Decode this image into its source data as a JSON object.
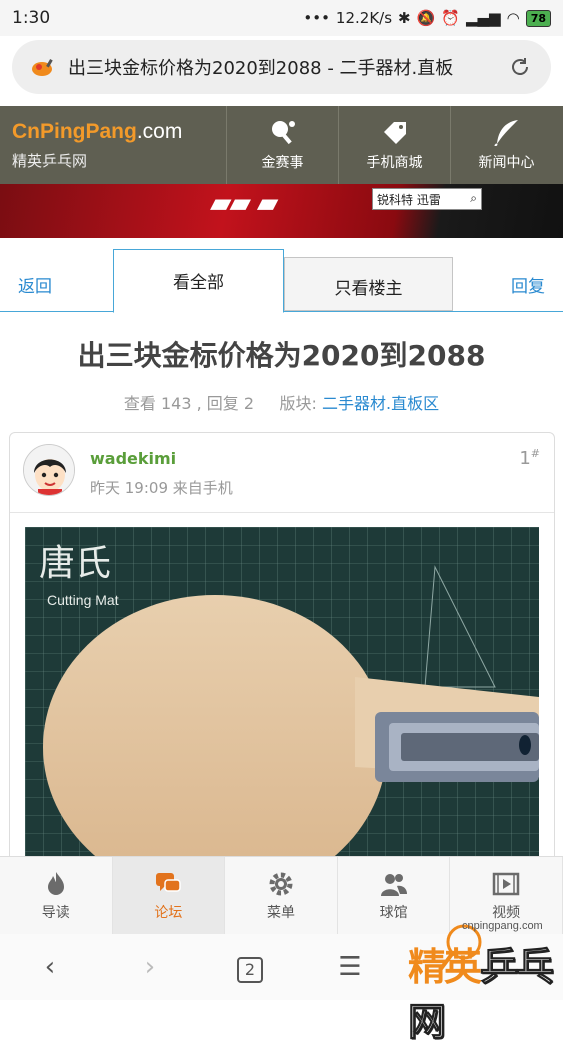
{
  "status_bar": {
    "time": "1:30",
    "network_speed": "12.2K/s",
    "battery": "78"
  },
  "browser": {
    "url_title": "出三块金标价格为2020到2088 - 二手器材.直板",
    "tab_count": "2"
  },
  "site": {
    "logo_brand": "CnPingPang",
    "logo_tld": ".com",
    "logo_subtitle": "精英乒乓网",
    "nav": [
      {
        "label": "金赛事",
        "icon": "paddle-icon"
      },
      {
        "label": "手机商城",
        "icon": "tag-icon"
      },
      {
        "label": "新闻中心",
        "icon": "feather-icon"
      }
    ]
  },
  "banner": {
    "search_text": "锐科特 迅雷"
  },
  "tabs": {
    "back": "返回",
    "all": "看全部",
    "op_only": "只看楼主",
    "reply": "回复"
  },
  "thread": {
    "title": "出三块金标价格为2020到2088",
    "views_label": "查看",
    "views": "143",
    "replies_label": "回复",
    "replies": "2",
    "board_label": "版块:",
    "board": "二手器材.直板区"
  },
  "post": {
    "author": "wadekimi",
    "time": "昨天 19:09 来自手机",
    "floor": "1",
    "floor_mark": "#",
    "photo_text_1": "唐氏",
    "photo_text_2": "Cutting Mat"
  },
  "bottom_nav": [
    {
      "label": "导读",
      "icon": "flame-icon",
      "active": false
    },
    {
      "label": "论坛",
      "icon": "chat-icon",
      "active": true
    },
    {
      "label": "菜单",
      "icon": "gear-icon",
      "active": false
    },
    {
      "label": "球馆",
      "icon": "people-icon",
      "active": false
    },
    {
      "label": "视频",
      "icon": "film-icon",
      "active": false
    }
  ],
  "watermark": {
    "url": "cnpingpang.com",
    "text_1": "精英",
    "text_2": "乒乓网"
  },
  "colors": {
    "header_bg": "#5f5f52",
    "accent_blue": "#2a8ad0",
    "accent_orange": "#e2731d",
    "author_green": "#5a9e3a"
  }
}
